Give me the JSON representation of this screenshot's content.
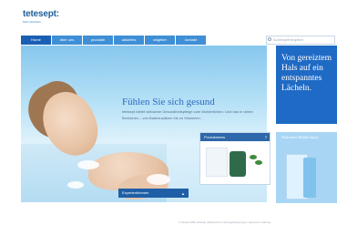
{
  "brand": {
    "logo": "tetesept:",
    "tagline": "Mehr Wohlsein"
  },
  "nav": [
    "Home",
    "über uns",
    "produkte",
    "aktuelles",
    "ratgeber",
    "kontakt"
  ],
  "search": {
    "placeholder": "Suchbegriff eingeben"
  },
  "hero": {
    "headline": "Fühlen Sie sich gesund",
    "body": "tetesept bietet wirksame Gesundheitspflege zum Wohlerfühlen. Und das in vielen Bereichen – von Badezusätzen bis zu Vitaminen."
  },
  "products": {
    "title": "Produktnews"
  },
  "expert": {
    "label": "Expertenthemen"
  },
  "right_top": {
    "text": "Von gereiztem Hals auf ein entspanntes Lächeln."
  },
  "right_bottom": {
    "text": "Halsweiter Rachen Spray"
  },
  "footer": {
    "text": "© tetesept 2008 | Sitemap | Datenschutz | Nutzungsbedingungen | Impressum | Sitemap"
  }
}
